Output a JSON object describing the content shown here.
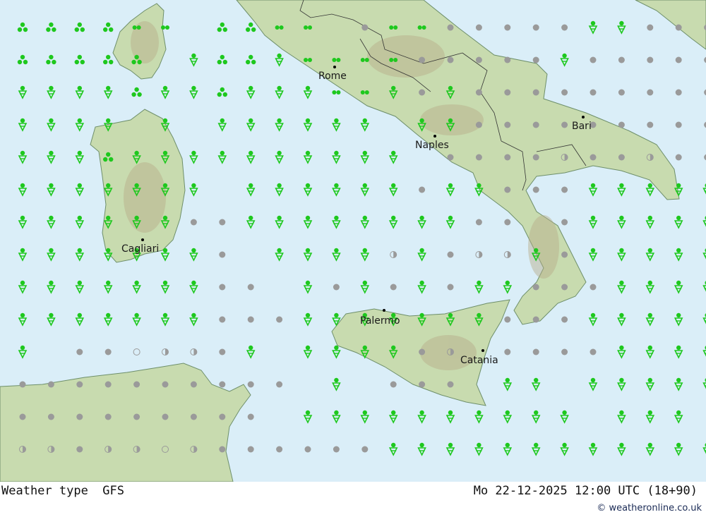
{
  "map": {
    "colors": {
      "sea": "#daeef8",
      "land": "#c8dbaf",
      "highland": "#b6aa88",
      "rain": "#1ec81e",
      "cloud": "#9a9a9a"
    },
    "cities": [
      {
        "name": "Rome"
      },
      {
        "name": "Naples"
      },
      {
        "name": "Bari"
      },
      {
        "name": "Cagliari"
      },
      {
        "name": "Palermo"
      },
      {
        "name": "Catania"
      }
    ],
    "legend_icons": [
      "light-rain-icon",
      "rain-icon",
      "rain-shower-icon",
      "overcast-icon",
      "partly-cloudy-icon",
      "clear-icon"
    ]
  },
  "footer": {
    "left": "Weather type  GFS",
    "right": "Mo 22-12-2025 12:00 UTC (18+90)",
    "credit": "© weatheronline.co.uk"
  }
}
